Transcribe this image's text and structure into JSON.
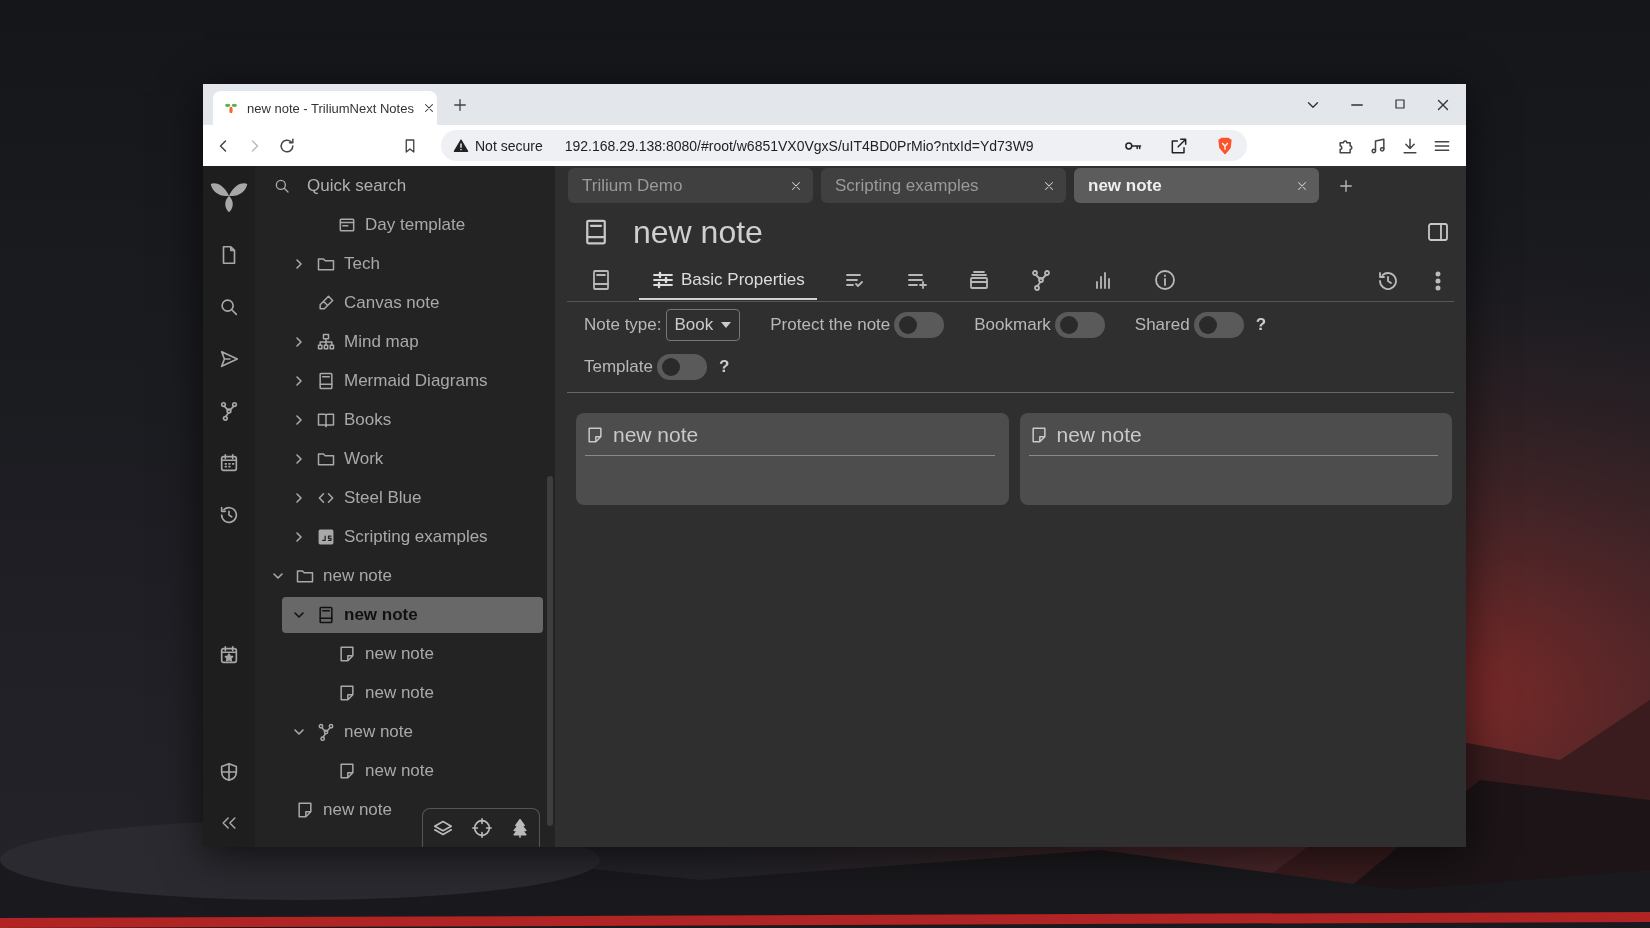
{
  "browser": {
    "tab": {
      "title": "new note - TriliumNext Notes",
      "selected": true
    },
    "security": "Not secure",
    "url": "192.168.29.138:8080/#root/w6851VX0VgxS/uIT4BD0PrMio?ntxId=Yd73W9"
  },
  "sidebar": {
    "search": {
      "placeholder": "Quick search"
    },
    "tree": [
      {
        "children": [
          {
            "children": [
              {
                "label": "Day template",
                "kind": "template",
                "selected": false
              }
            ]
          },
          {
            "label": "Tech",
            "kind": "folder",
            "expanded": false,
            "selected": false
          },
          {
            "label": "Canvas note",
            "kind": "canvas",
            "selected": false
          },
          {
            "label": "Mind map",
            "kind": "mindmap",
            "expanded": false,
            "selected": false
          },
          {
            "label": "Mermaid Diagrams",
            "kind": "book",
            "expanded": false,
            "selected": false
          },
          {
            "label": "Books",
            "kind": "book-open",
            "expanded": false,
            "selected": false
          },
          {
            "label": "Work",
            "kind": "folder",
            "expanded": false,
            "selected": false
          },
          {
            "label": "Steel Blue",
            "kind": "code",
            "expanded": false,
            "selected": false
          },
          {
            "label": "Scripting examples",
            "kind": "js",
            "expanded": false,
            "selected": false
          }
        ]
      },
      {
        "label": "new note",
        "kind": "folder",
        "expanded": true,
        "selected": false,
        "children": [
          {
            "label": "new note",
            "kind": "book",
            "expanded": true,
            "selected": true,
            "children": [
              {
                "label": "new note",
                "kind": "text",
                "selected": false
              },
              {
                "label": "new note",
                "kind": "text",
                "selected": false
              }
            ]
          },
          {
            "label": "new note",
            "kind": "relation-map",
            "expanded": true,
            "selected": false,
            "children": [
              {
                "label": "new note",
                "kind": "text",
                "selected": false
              }
            ]
          }
        ]
      },
      {
        "label": "new note",
        "kind": "text",
        "selected": false
      }
    ]
  },
  "note_tabs": [
    {
      "title": "Trilium Demo",
      "selected": false
    },
    {
      "title": "Scripting examples",
      "selected": false
    },
    {
      "title": "new note",
      "selected": true
    }
  ],
  "note": {
    "title": "new note",
    "ribbon_tabs": [
      {
        "selected": false
      },
      {
        "label": "Basic Properties",
        "selected": true
      },
      {
        "selected": false
      },
      {
        "selected": false
      },
      {
        "selected": false
      },
      {
        "selected": false
      },
      {
        "selected": false
      },
      {
        "selected": false
      }
    ],
    "properties": {
      "note_type_label": "Note type:",
      "note_type": "Book",
      "toggles": [
        {
          "label": "Protect the note",
          "on": false
        },
        {
          "label": "Bookmark",
          "on": false
        },
        {
          "label": "Shared",
          "on": false,
          "help": "?"
        },
        {
          "label": "Template",
          "on": false,
          "help": "?"
        }
      ]
    },
    "children": [
      {
        "title": "new note"
      },
      {
        "title": "new note"
      }
    ]
  }
}
